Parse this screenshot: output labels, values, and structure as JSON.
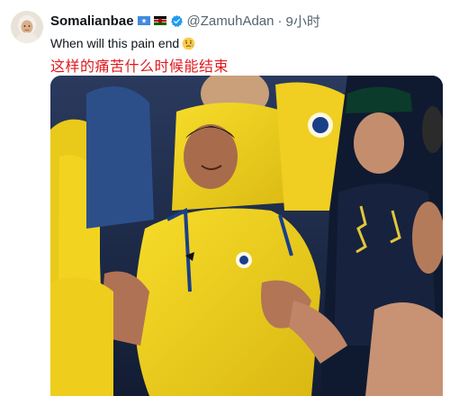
{
  "author": {
    "display_name": "Somalianbae",
    "handle": "@ZamuhAdan",
    "separator": "·",
    "timestamp": "9小时",
    "badges": [
      "somalia-flag-icon",
      "kenya-flag-icon",
      "verified-badge-icon"
    ]
  },
  "tweet": {
    "text": "When will this pain end",
    "emoji": "worried-face-emoji",
    "translation": "这样的痛苦什么时候能结束"
  },
  "media": {
    "description_icon": "photo",
    "colors": {
      "jersey_yellow": "#f3d21c",
      "crowd_navy": "#1a2c4e",
      "translation_red": "#e0191e",
      "verified_blue": "#1d9bf0"
    }
  }
}
